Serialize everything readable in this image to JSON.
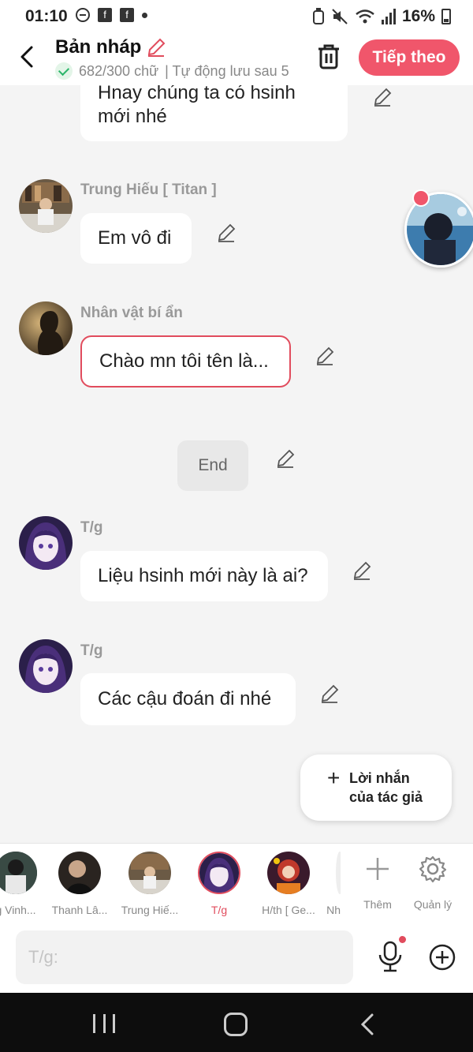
{
  "status": {
    "time": "01:10",
    "battery": "16%"
  },
  "header": {
    "title": "Bản nháp",
    "word_count": "682/300 chữ",
    "autosave": "| Tự động lưu sau 5",
    "next_label": "Tiếp theo"
  },
  "messages": [
    {
      "name": "",
      "text_lines": [
        "Hnay chúng ta có hsinh",
        "mới nhé"
      ]
    },
    {
      "name": "Trung Hiếu [ Titan ]",
      "text": "Em vô đi"
    },
    {
      "name": "Nhân vật bí ẩn",
      "text": "Chào mn tôi tên là..."
    },
    {
      "name": "",
      "text": "End"
    },
    {
      "name": "T/g",
      "text": "Liệu hsinh mới này là ai?"
    },
    {
      "name": "T/g",
      "text": "Các cậu đoán đi nhé"
    }
  ],
  "author_note": {
    "line1": "Lời nhắn",
    "line2": "của tác giả"
  },
  "characters": [
    {
      "label": "g Vinh..."
    },
    {
      "label": "Thanh Lâ..."
    },
    {
      "label": "Trung Hiế..."
    },
    {
      "label": "T/g"
    },
    {
      "label": "H/th [ Ge..."
    },
    {
      "label": "Nh"
    }
  ],
  "tools": {
    "add_label": "Thêm",
    "manage_label": "Quản lý"
  },
  "input": {
    "placeholder": "T/g:"
  },
  "colors": {
    "accent": "#f0566b",
    "selected_border": "#e14c5d",
    "nav_bg": "#0d0d0d"
  }
}
